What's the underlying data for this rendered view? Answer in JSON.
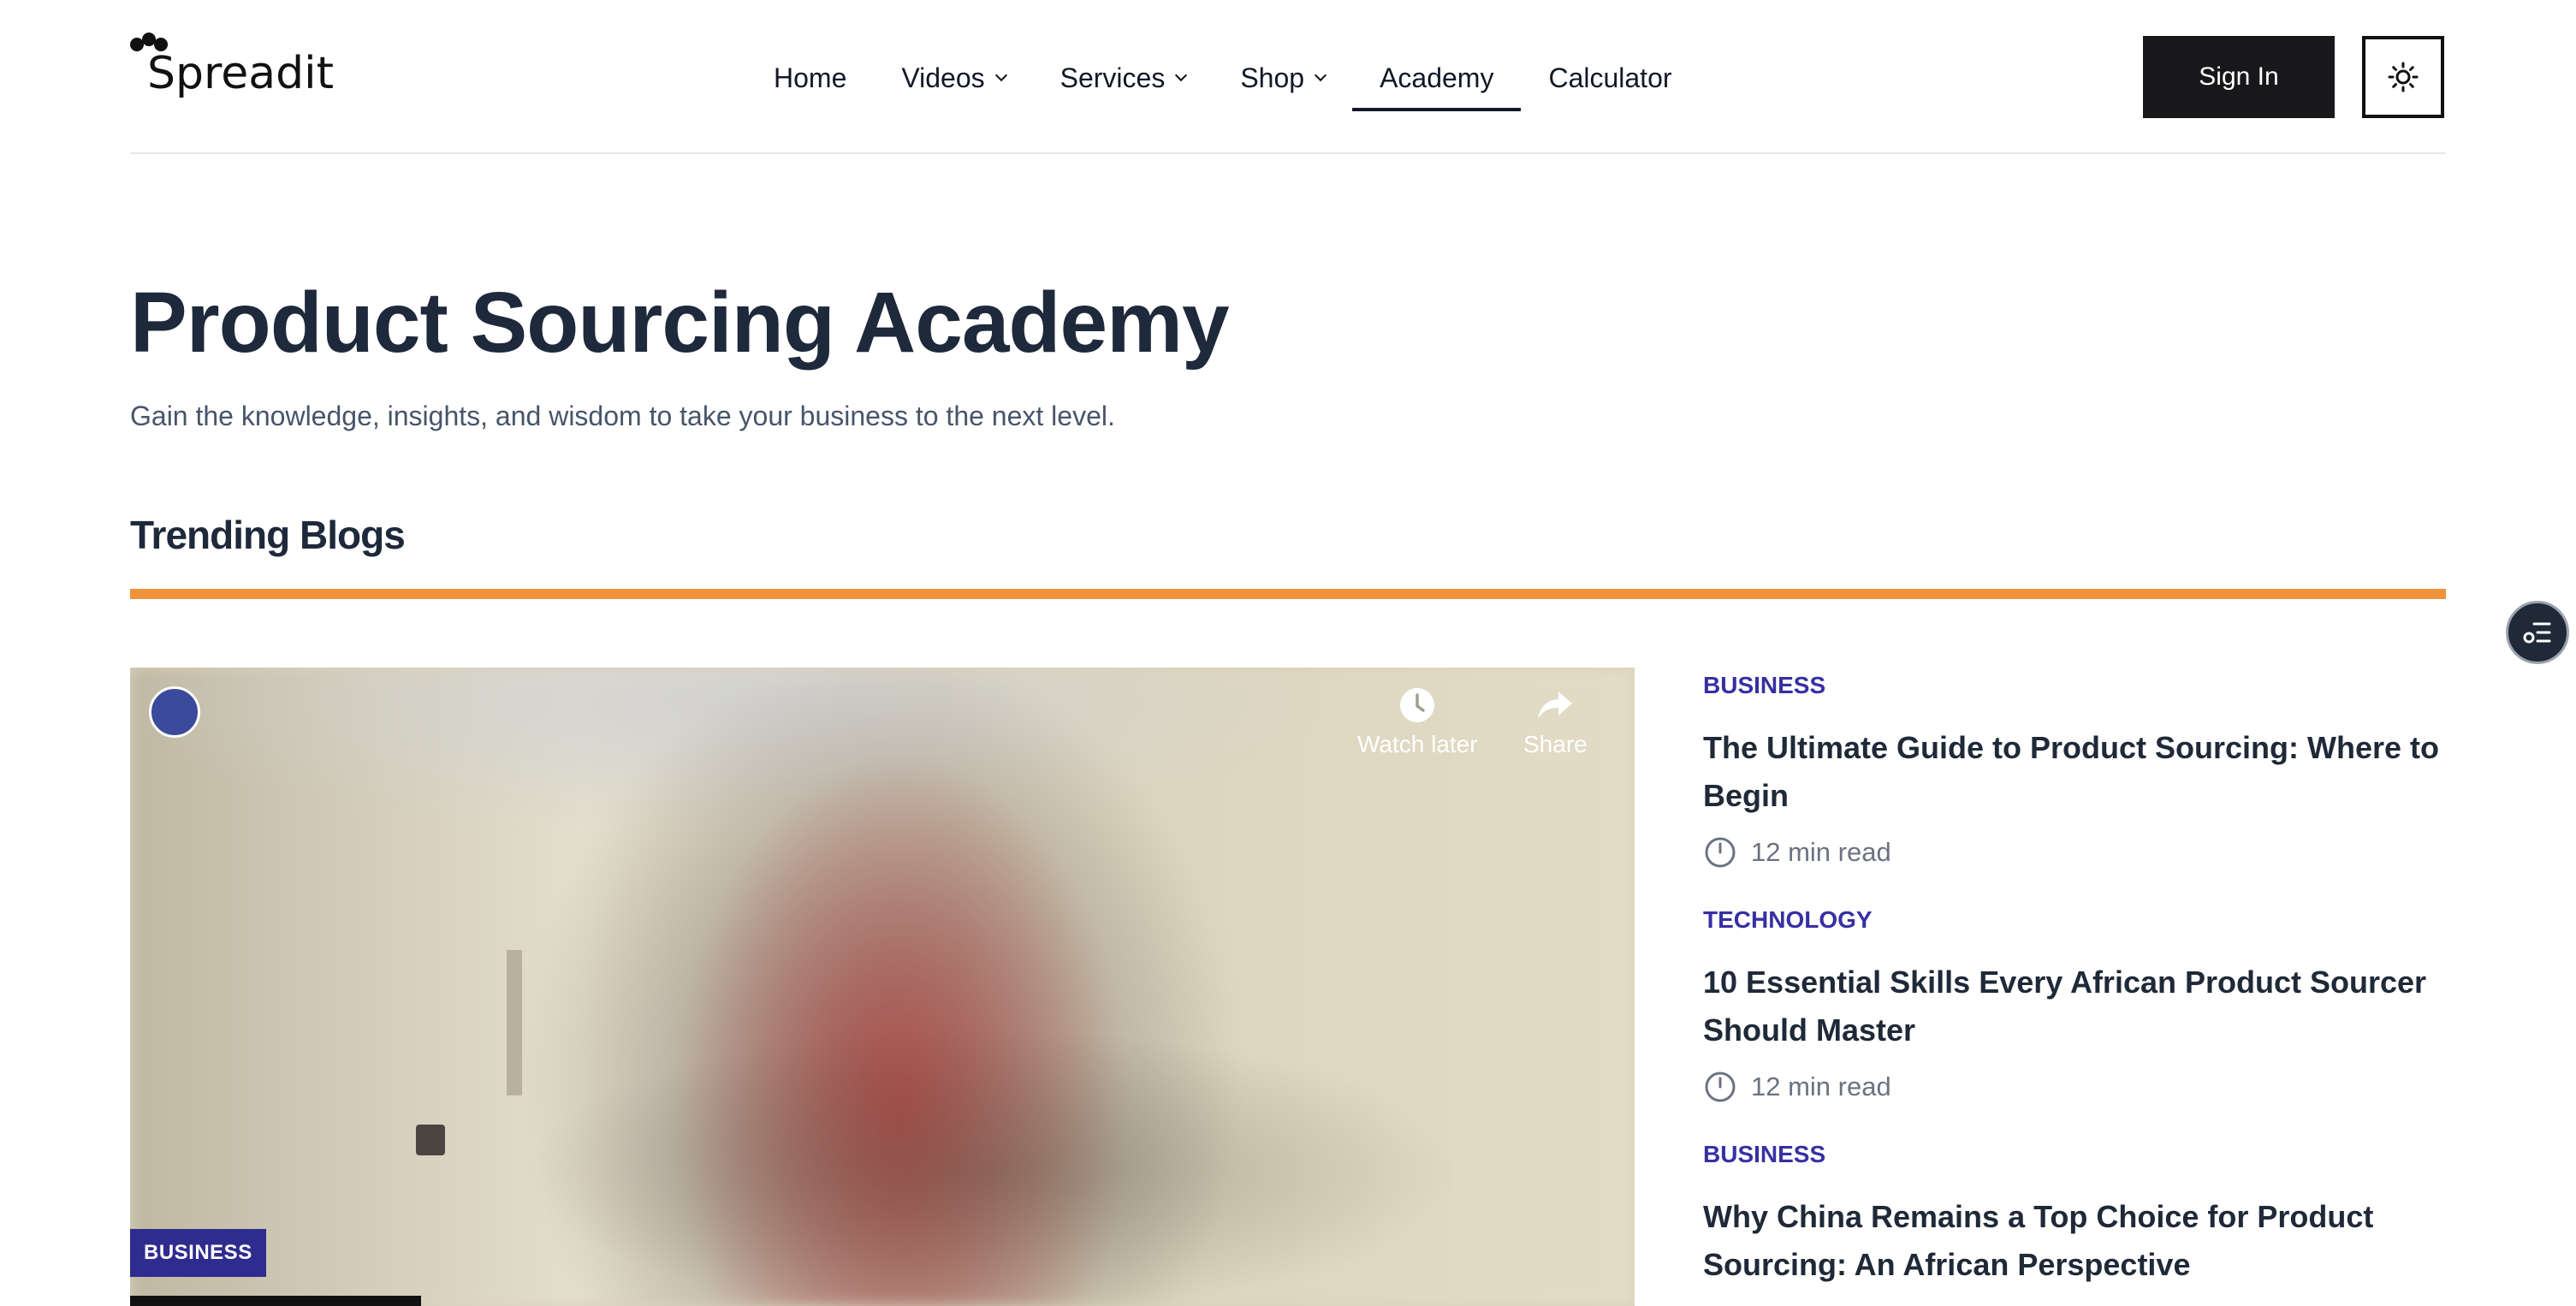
{
  "brand": {
    "name": "Spreadit"
  },
  "nav": {
    "items": [
      {
        "label": "Home",
        "dropdown": false,
        "active": false
      },
      {
        "label": "Videos",
        "dropdown": true,
        "active": false
      },
      {
        "label": "Services",
        "dropdown": true,
        "active": false
      },
      {
        "label": "Shop",
        "dropdown": true,
        "active": false
      },
      {
        "label": "Academy",
        "dropdown": false,
        "active": true
      },
      {
        "label": "Calculator",
        "dropdown": false,
        "active": false
      }
    ],
    "sign_in": "Sign In",
    "theme_icon": "sun-icon"
  },
  "hero": {
    "title": "Product Sourcing Academy",
    "subtitle": "Gain the knowledge, insights, and wisdom to take your business to the next level."
  },
  "trending": {
    "heading": "Trending Blogs",
    "accent_color": "#f0923a",
    "video": {
      "watch_later": "Watch later",
      "share": "Share",
      "category": "BUSINESS"
    },
    "blogs": [
      {
        "category": "BUSINESS",
        "title": "The Ultimate Guide to Product Sourcing: Where to Begin",
        "read_time": "12 min read"
      },
      {
        "category": "TECHNOLOGY",
        "title": "10 Essential Skills Every African Product Sourcer Should Master",
        "read_time": "12 min read"
      },
      {
        "category": "BUSINESS",
        "title": "Why China Remains a Top Choice for Product Sourcing: An African Perspective",
        "read_time": ""
      }
    ]
  },
  "colors": {
    "category": "#3730a3",
    "sign_in_bg": "#18181b"
  }
}
